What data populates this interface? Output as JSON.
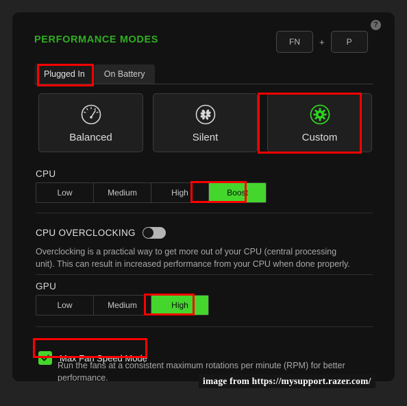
{
  "header": {
    "title": "PERFORMANCE MODES",
    "shortcut": {
      "key1": "FN",
      "separator": "+",
      "key2": "P"
    },
    "help_icon_glyph": "?"
  },
  "tabs": [
    {
      "label": "Plugged In",
      "active": true
    },
    {
      "label": "On Battery",
      "active": false
    }
  ],
  "modes": [
    {
      "label": "Balanced",
      "icon": "gauge-icon",
      "selected": false
    },
    {
      "label": "Silent",
      "icon": "fan-icon",
      "selected": false
    },
    {
      "label": "Custom",
      "icon": "gear-icon",
      "selected": true
    }
  ],
  "cpu": {
    "label": "CPU",
    "options": [
      "Low",
      "Medium",
      "High",
      "Boost"
    ],
    "selected": "Boost"
  },
  "overclocking": {
    "title": "CPU OVERCLOCKING",
    "toggle_state": "off",
    "description": "Overclocking is a practical way to get more out of your CPU (central processing unit). This can result in increased performance from your CPU when done properly."
  },
  "gpu": {
    "label": "GPU",
    "options": [
      "Low",
      "Medium",
      "High"
    ],
    "selected": "High"
  },
  "max_fan": {
    "label": "Max Fan Speed Mode",
    "checked": true,
    "check_glyph": "✓",
    "description": "Run the fans at a consistent maximum rotations per minute (RPM) for better performance."
  },
  "watermark": {
    "text": "image from https://mysupport.razer.com/"
  },
  "colors": {
    "accent_green": "#44d62c",
    "title_green": "#2fae21",
    "annotation_red": "#fe0000",
    "panel_bg": "#121212",
    "outer_bg": "#232323"
  }
}
